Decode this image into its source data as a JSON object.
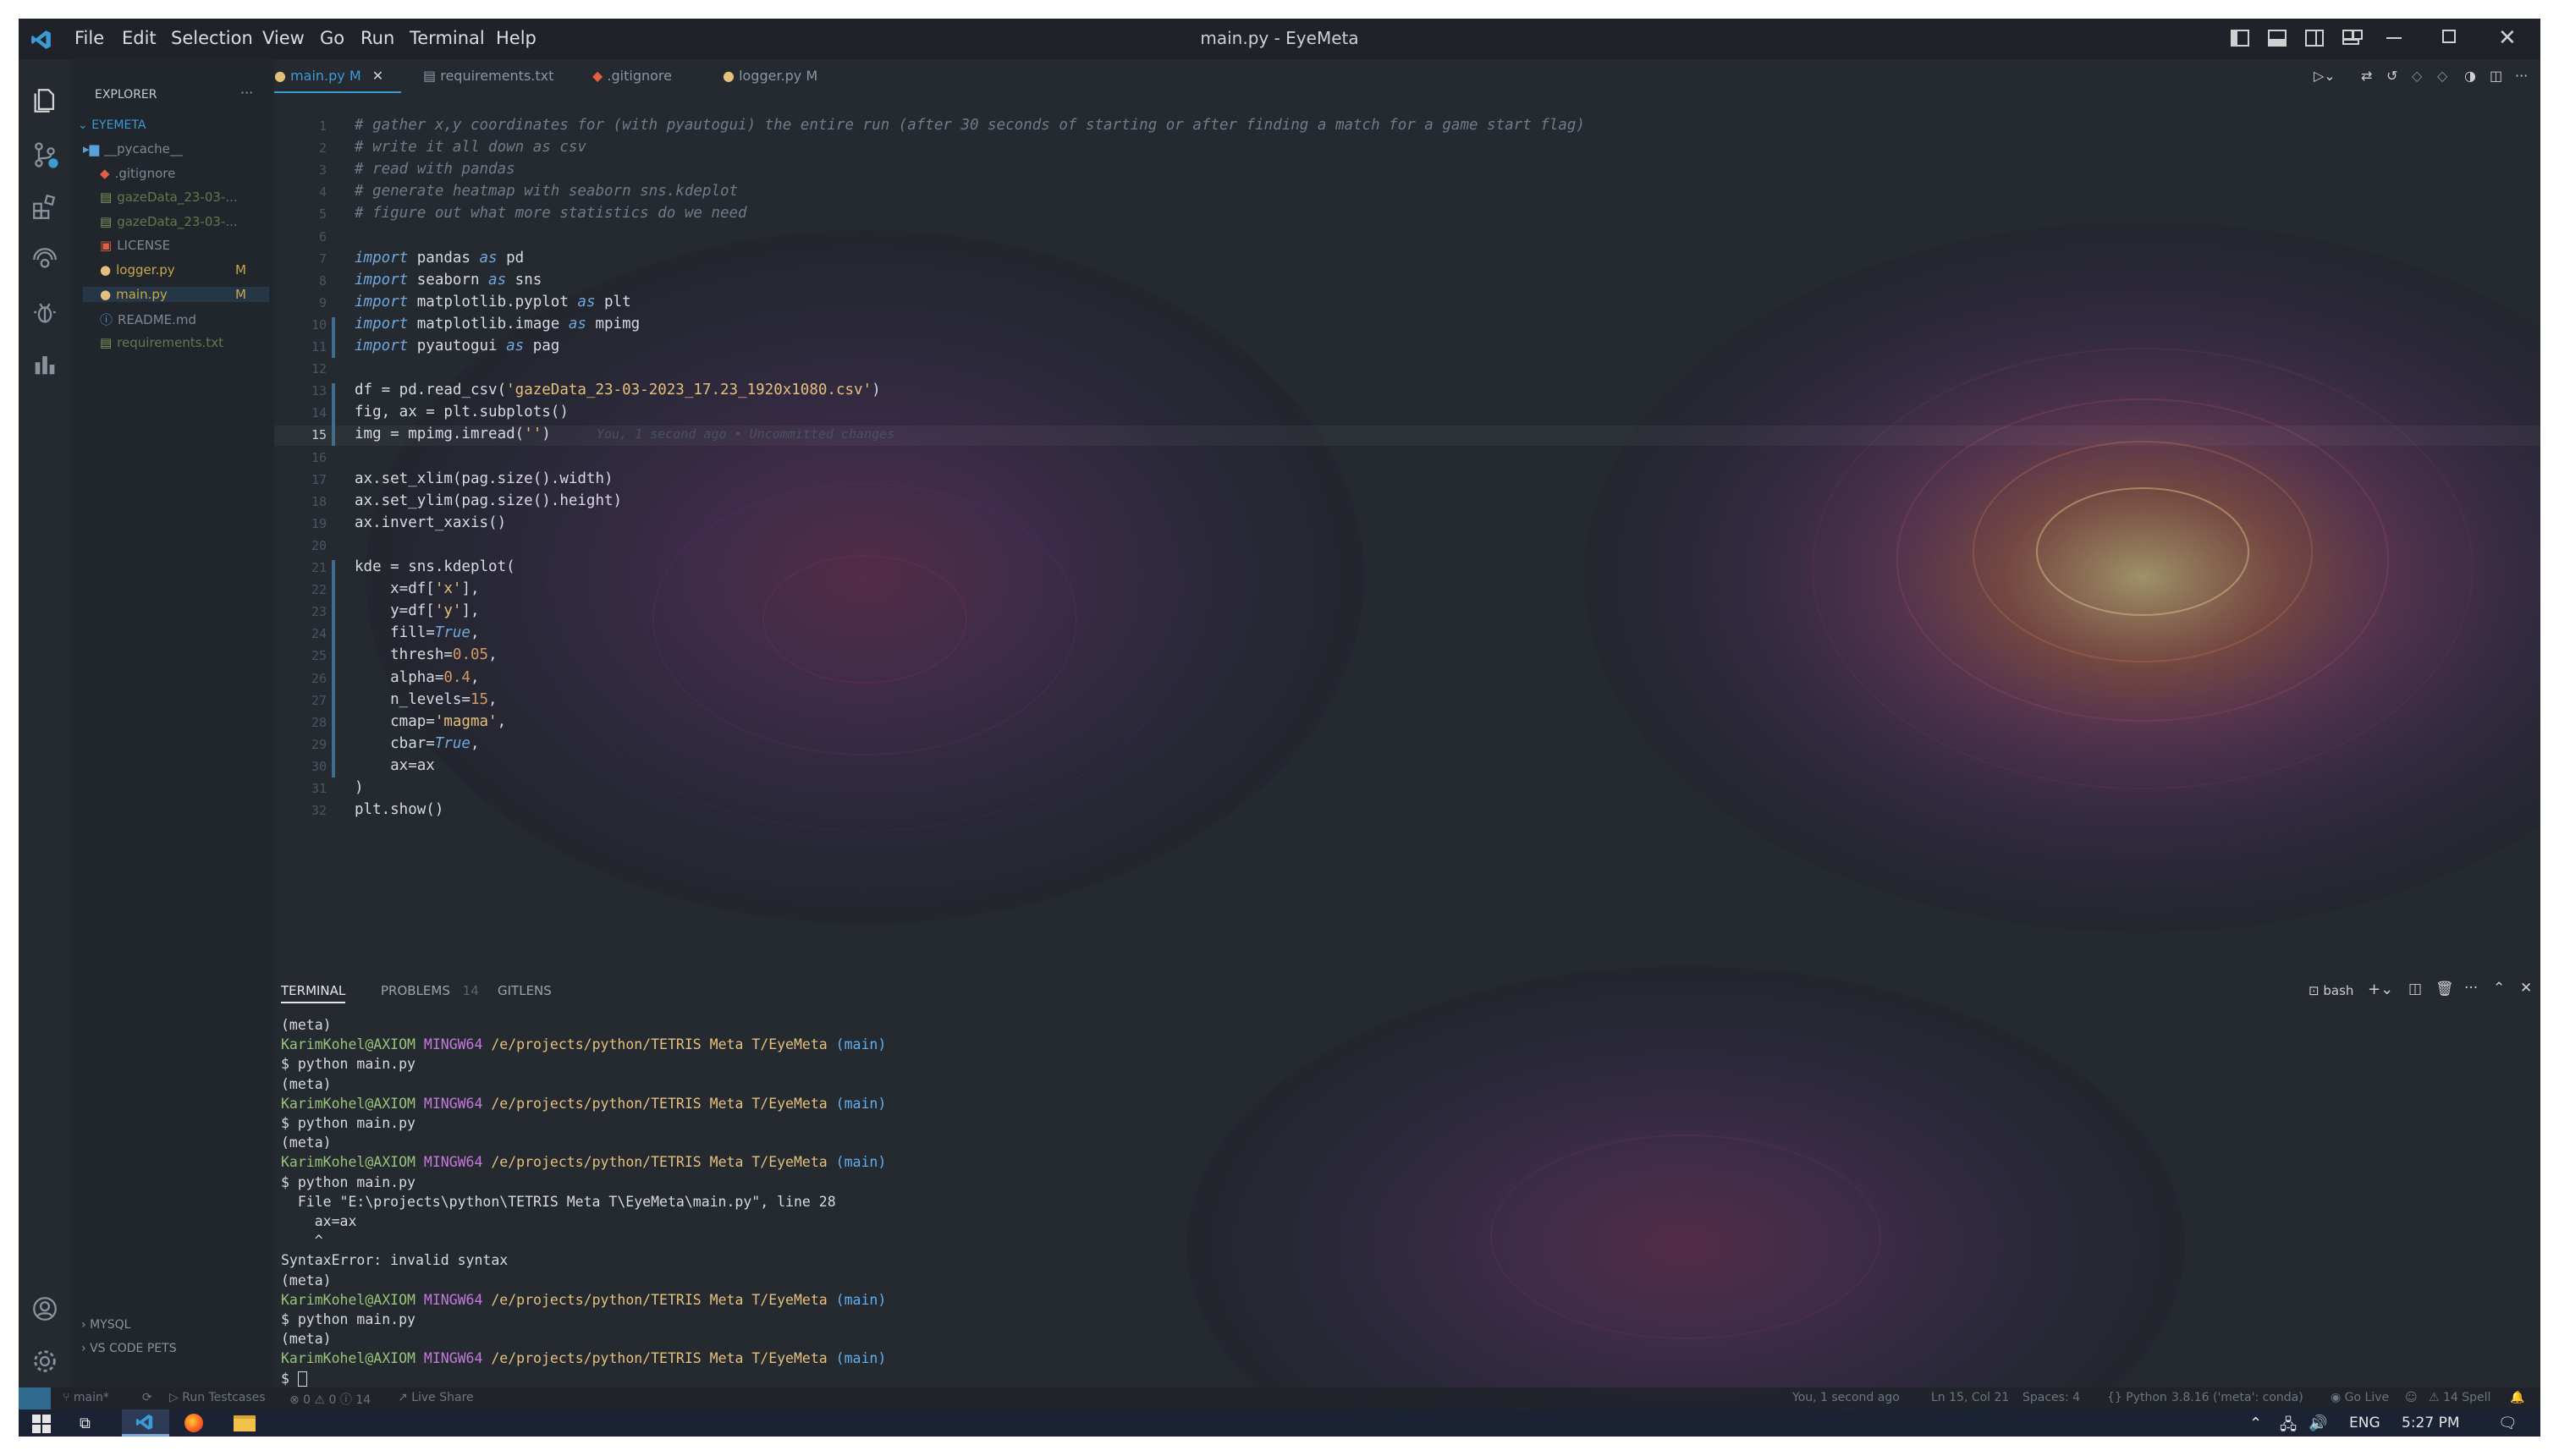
{
  "window": {
    "title": "main.py - EyeMeta",
    "menu": [
      "File",
      "Edit",
      "Selection",
      "View",
      "Go",
      "Run",
      "Terminal",
      "Help"
    ]
  },
  "explorer": {
    "header": "EXPLORER",
    "root": "EYEMETA",
    "files": [
      {
        "name": "__pycache__",
        "icon": "folder-icon",
        "badge": ""
      },
      {
        "name": ".gitignore",
        "icon": "git-icon",
        "badge": ""
      },
      {
        "name": "gazeData_23-03-...",
        "icon": "file-icon",
        "badge": ""
      },
      {
        "name": "gazeData_23-03-...",
        "icon": "file-icon",
        "badge": ""
      },
      {
        "name": "LICENSE",
        "icon": "license-icon",
        "badge": ""
      },
      {
        "name": "logger.py",
        "icon": "python-icon",
        "badge": "M"
      },
      {
        "name": "main.py",
        "icon": "python-icon",
        "badge": "M"
      },
      {
        "name": "README.md",
        "icon": "info-icon",
        "badge": ""
      },
      {
        "name": "requirements.txt",
        "icon": "file-icon",
        "badge": ""
      }
    ],
    "sections": [
      "MYSQL",
      "VS CODE PETS"
    ]
  },
  "tabs": [
    {
      "label": "main.py",
      "badge": "M",
      "active": true
    },
    {
      "label": "requirements.txt",
      "badge": "",
      "active": false
    },
    {
      "label": ".gitignore",
      "badge": "",
      "active": false
    },
    {
      "label": "logger.py",
      "badge": "M",
      "active": false
    }
  ],
  "editor": {
    "inline_blame": "You, 1 second ago • Uncommitted changes",
    "lines": [
      "# gather x,y coordinates for (with pyautogui) the entire run (after 30 seconds of starting or after finding a match for a game start flag)",
      "# write it all down as csv",
      "# read with pandas",
      "# generate heatmap with seaborn sns.kdeplot",
      "# figure out what more statistics do we need",
      "",
      "import pandas as pd",
      "import seaborn as sns",
      "import matplotlib.pyplot as plt",
      "import matplotlib.image as mpimg",
      "import pyautogui as pag",
      "",
      "df = pd.read_csv('gazeData_23-03-2023_17.23_1920x1080.csv')",
      "fig, ax = plt.subplots()",
      "img = mpimg.imread('')",
      "",
      "ax.set_xlim(pag.size().width)",
      "ax.set_ylim(pag.size().height)",
      "ax.invert_xaxis()",
      "",
      "kde = sns.kdeplot(",
      "    x=df['x'],",
      "    y=df['y'],",
      "    fill=True,",
      "    thresh=0.05,",
      "    alpha=0.4,",
      "    n_levels=15,",
      "    cmap='magma',",
      "    cbar=True,",
      "    ax=ax",
      ")",
      "plt.show()"
    ]
  },
  "panel": {
    "tabs": [
      {
        "label": "TERMINAL",
        "count": ""
      },
      {
        "label": "PROBLEMS",
        "count": "14"
      },
      {
        "label": "GITLENS",
        "count": ""
      }
    ],
    "shell": "bash",
    "terminal_lines": [
      "(meta)",
      "KarimKohel@AXIOM MINGW64 /e/projects/python/TETRIS Meta T/EyeMeta (main)",
      "$ python main.py",
      "(meta)",
      "KarimKohel@AXIOM MINGW64 /e/projects/python/TETRIS Meta T/EyeMeta (main)",
      "$ python main.py",
      "(meta)",
      "KarimKohel@AXIOM MINGW64 /e/projects/python/TETRIS Meta T/EyeMeta (main)",
      "$ python main.py",
      "  File \"E:\\projects\\python\\TETRIS Meta T\\EyeMeta\\main.py\", line 28",
      "    ax=ax",
      "    ^",
      "SyntaxError: invalid syntax",
      "(meta)",
      "KarimKohel@AXIOM MINGW64 /e/projects/python/TETRIS Meta T/EyeMeta (main)",
      "$ python main.py",
      "(meta)",
      "KarimKohel@AXIOM MINGW64 /e/projects/python/TETRIS Meta T/EyeMeta (main)",
      "$ "
    ]
  },
  "statusbar": {
    "branch": "main*",
    "run_testcases": "Run Testcases",
    "problems": "⊗ 0  ⚠ 0  ⓘ 14",
    "live_share": "Live Share",
    "blame": "You, 1 second ago",
    "cursor": "Ln 15, Col 21",
    "spaces": "Spaces: 4",
    "language": "Python",
    "interpreter": "3.8.16 ('meta': conda)",
    "go_live": "Go Live",
    "spell": "14 Spell"
  },
  "taskbar": {
    "language": "ENG",
    "time": "5:27 PM"
  },
  "colors": {
    "background": "#252a31",
    "accent": "#3c9ad4",
    "comment": "#6f7b88",
    "keyword": "#6fa8dc",
    "string": "#e5c07b"
  }
}
